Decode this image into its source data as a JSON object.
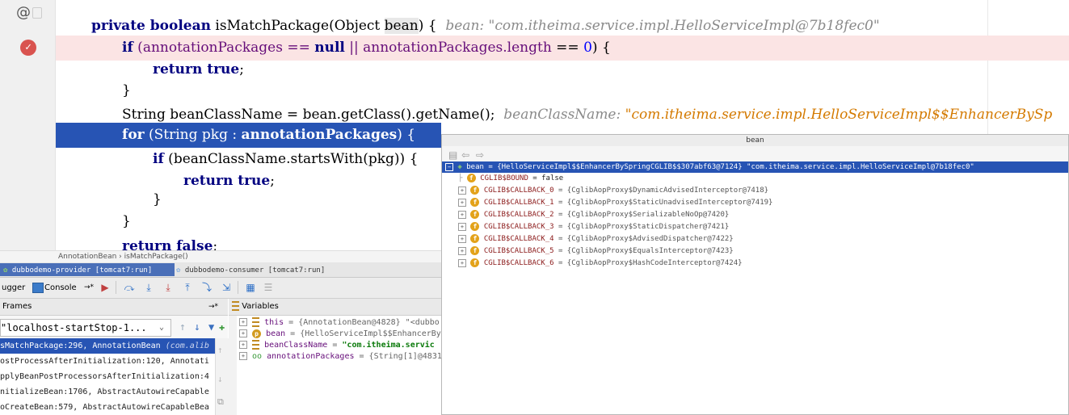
{
  "editor": {
    "lines": [
      {
        "kind": "method-sig",
        "keyword": "private boolean",
        "name": " isMatchPackage(Object ",
        "param": "bean",
        "tail": ") {",
        "hint_label": "bean: ",
        "hint_value": "\"com.itheima.service.impl.HelloServiceImpl@7b18fec0\""
      },
      {
        "kind": "breakpoint",
        "text_if": "if",
        "text_mid": " (annotationPackages == ",
        "kw_null": "null",
        "text_or": " || annotationPackages.",
        "fld_length": "length",
        "text_eq": " == ",
        "num": "0",
        "text_end": ") {"
      },
      {
        "kind": "plain",
        "kw": "return true",
        "text": ";"
      },
      {
        "kind": "plain",
        "text": "}"
      },
      {
        "kind": "hint",
        "text": "String beanClassName = bean.getClass().getName();",
        "hint_label": "beanClassName: ",
        "hint_value": "\"com.itheima.service.impl.HelloServiceImpl$$EnhancerBySp"
      },
      {
        "kind": "current",
        "kw": "for",
        "text": " (String pkg : ",
        "fld": "annotationPackages",
        "tail": ") {"
      },
      {
        "kind": "plain",
        "kw": "if",
        "text": " (beanClassName.startsWith(pkg)) {"
      },
      {
        "kind": "plain",
        "kw": "return true",
        "text": ";"
      },
      {
        "kind": "plain",
        "text": "}"
      },
      {
        "kind": "plain",
        "text": "}"
      },
      {
        "kind": "plain",
        "kw": "return false",
        "text": ";"
      }
    ]
  },
  "breadcrumb": {
    "class": "AnnotationBean",
    "sep": "›",
    "method": "isMatchPackage()"
  },
  "run_tabs": [
    {
      "label": "dubbodemo-provider [tomcat7:run]",
      "active": true
    },
    {
      "label": "dubbodemo-consumer [tomcat7:run]",
      "active": false
    }
  ],
  "debugger": {
    "tab_debugger": "ugger",
    "tab_console": "Console",
    "console_arrow": "→*"
  },
  "frames": {
    "header": "Frames",
    "header_arrow": "→*",
    "thread": "\"localhost-startStop-1...",
    "items": [
      {
        "method": "sMatchPackage:296, AnnotationBean ",
        "cls": "(com.alib",
        "selected": true
      },
      {
        "method": "ostProcessAfterInitialization:120, Annotati",
        "cls": "",
        "selected": false
      },
      {
        "method": "pplyBeanPostProcessorsAfterInitialization:4",
        "cls": "",
        "selected": false
      },
      {
        "method": "nitializeBean:1706, AbstractAutowireCapable",
        "cls": "",
        "selected": false
      },
      {
        "method": "oCreateBean:579, AbstractAutowireCapableBea",
        "cls": "",
        "selected": false
      }
    ]
  },
  "variables": {
    "header": "Variables",
    "items": [
      {
        "icon": "lines",
        "name": "this",
        "value": " = {AnnotationBean@4828} \"<dubbo:a"
      },
      {
        "icon": "p",
        "name": "bean",
        "value": " = {HelloServiceImpl$$EnhancerBySp"
      },
      {
        "icon": "lines",
        "name": "beanClassName",
        "value": " = ",
        "str": "\"com.itheima.servic"
      },
      {
        "icon": "oo",
        "name": "annotationPackages",
        "value": " = {String[1]@4831}"
      }
    ]
  },
  "popup": {
    "title": "bean",
    "root": {
      "name": "bean",
      "value": " = {HelloServiceImpl$$EnhancerBySpringCGLIB$$307abf63@7124} \"com.itheima.service.impl.HelloServiceImpl@7b18fec0\""
    },
    "fields": [
      {
        "name": "CGLIB$BOUND",
        "value": " = false",
        "expandable": false
      },
      {
        "name": "CGLIB$CALLBACK_0",
        "value": " = {CglibAopProxy$DynamicAdvisedInterceptor@7418}",
        "expandable": true
      },
      {
        "name": "CGLIB$CALLBACK_1",
        "value": " = {CglibAopProxy$StaticUnadvisedInterceptor@7419}",
        "expandable": true
      },
      {
        "name": "CGLIB$CALLBACK_2",
        "value": " = {CglibAopProxy$SerializableNoOp@7420}",
        "expandable": true
      },
      {
        "name": "CGLIB$CALLBACK_3",
        "value": " = {CglibAopProxy$StaticDispatcher@7421}",
        "expandable": true
      },
      {
        "name": "CGLIB$CALLBACK_4",
        "value": " = {CglibAopProxy$AdvisedDispatcher@7422}",
        "expandable": true
      },
      {
        "name": "CGLIB$CALLBACK_5",
        "value": " = {CglibAopProxy$EqualsInterceptor@7423}",
        "expandable": true
      },
      {
        "name": "CGLIB$CALLBACK_6",
        "value": " = {CglibAopProxy$HashCodeInterceptor@7424}",
        "expandable": true
      }
    ]
  },
  "colors": {
    "current_line": "#2754b4",
    "breakpoint_line": "#fbe4e4",
    "keyword": "#000080",
    "field": "#660e7a",
    "hint_string": "#d47a00"
  }
}
